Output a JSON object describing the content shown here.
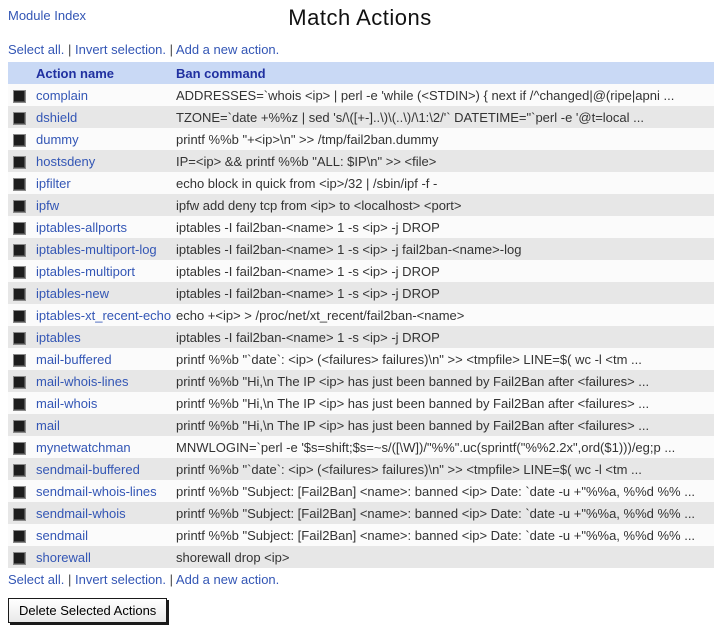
{
  "page": {
    "module_index_label": "Module Index",
    "title": "Match Actions"
  },
  "action_links": {
    "separator": "|",
    "items": [
      {
        "id": "select-all-link",
        "label": "Select all."
      },
      {
        "id": "invert-selection-link",
        "label": "Invert selection."
      },
      {
        "id": "add-new-action-link",
        "label": "Add a new action."
      }
    ]
  },
  "table": {
    "headers": {
      "action_name": "Action name",
      "ban_command": "Ban command"
    },
    "rows": [
      {
        "name": "complain",
        "command": "ADDRESSES=`whois <ip> | perl -e 'while (<STDIN>) { next if /^changed|@(ripe|apni ..."
      },
      {
        "name": "dshield",
        "command": "TZONE=`date +%%z | sed 's/\\([+-]..\\)\\(..\\)/\\1:\\2/'` DATETIME=\"`perl -e '@t=local ..."
      },
      {
        "name": "dummy",
        "command": "printf %%b \"+<ip>\\n\" >> /tmp/fail2ban.dummy"
      },
      {
        "name": "hostsdeny",
        "command": "IP=<ip> && printf %%b \"ALL: $IP\\n\" >> <file>"
      },
      {
        "name": "ipfilter",
        "command": "echo block in quick from <ip>/32 | /sbin/ipf -f -"
      },
      {
        "name": "ipfw",
        "command": "ipfw add deny tcp from <ip> to <localhost> <port>"
      },
      {
        "name": "iptables-allports",
        "command": "iptables -I fail2ban-<name> 1 -s <ip> -j DROP"
      },
      {
        "name": "iptables-multiport-log",
        "command": "iptables -I fail2ban-<name> 1 -s <ip> -j fail2ban-<name>-log"
      },
      {
        "name": "iptables-multiport",
        "command": "iptables -I fail2ban-<name> 1 -s <ip> -j DROP"
      },
      {
        "name": "iptables-new",
        "command": "iptables -I fail2ban-<name> 1 -s <ip> -j DROP"
      },
      {
        "name": "iptables-xt_recent-echo",
        "command": "echo +<ip> > /proc/net/xt_recent/fail2ban-<name>"
      },
      {
        "name": "iptables",
        "command": "iptables -I fail2ban-<name> 1 -s <ip> -j DROP"
      },
      {
        "name": "mail-buffered",
        "command": "printf %%b \"`date`: <ip> (<failures> failures)\\n\" >> <tmpfile> LINE=$( wc -l <tm ..."
      },
      {
        "name": "mail-whois-lines",
        "command": "printf %%b \"Hi,\\n The IP <ip> has just been banned by Fail2Ban after <failures> ..."
      },
      {
        "name": "mail-whois",
        "command": "printf %%b \"Hi,\\n The IP <ip> has just been banned by Fail2Ban after <failures> ..."
      },
      {
        "name": "mail",
        "command": "printf %%b \"Hi,\\n The IP <ip> has just been banned by Fail2Ban after <failures> ..."
      },
      {
        "name": "mynetwatchman",
        "command": "MNWLOGIN=`perl -e '$s=shift;$s=~s/([\\W])/\"%%\".uc(sprintf(\"%%2.2x\",ord($1)))/eg;p ..."
      },
      {
        "name": "sendmail-buffered",
        "command": "printf %%b \"`date`: <ip> (<failures> failures)\\n\" >> <tmpfile> LINE=$( wc -l <tm ..."
      },
      {
        "name": "sendmail-whois-lines",
        "command": "printf %%b \"Subject: [Fail2Ban] <name>: banned <ip> Date: `date -u +\"%%a, %%d %% ..."
      },
      {
        "name": "sendmail-whois",
        "command": "printf %%b \"Subject: [Fail2Ban] <name>: banned <ip> Date: `date -u +\"%%a, %%d %% ..."
      },
      {
        "name": "sendmail",
        "command": "printf %%b \"Subject: [Fail2Ban] <name>: banned <ip> Date: `date -u +\"%%a, %%d %% ..."
      },
      {
        "name": "shorewall",
        "command": "shorewall drop <ip>"
      }
    ]
  },
  "footer": {
    "delete_button_label": "Delete Selected Actions"
  },
  "colors": {
    "header_bg": "#c9d9f5",
    "header_text": "#2030a0",
    "link": "#3356b5",
    "row_light": "#fbfbfb",
    "row_dark": "#e7e7e7"
  }
}
